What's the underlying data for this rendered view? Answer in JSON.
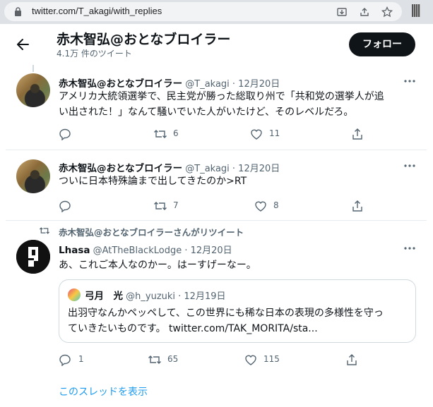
{
  "browser": {
    "url": "twitter.com/T_akagi/with_replies",
    "icons": [
      "lock-icon",
      "install-icon",
      "share-icon",
      "star-icon",
      "extension-icon"
    ]
  },
  "header": {
    "name": "赤木智弘@おとなブロイラー",
    "tweet_count": "4.1万 件のツイート",
    "follow_label": "フォロー"
  },
  "tweets": [
    {
      "name": "赤木智弘@おとなブロイラー",
      "handle_date": "@T_akagi · 12月20日",
      "text_line1": "アメリカ大統領選挙で、民主党が勝った総取り州で「共和党の選挙人が追",
      "text_line2": "い出された！」なんて騒いでいた人がいたけど、そのレベルだろ。",
      "reply_count": "",
      "retweet_count": "6",
      "like_count": "11"
    },
    {
      "name": "赤木智弘@おとなブロイラー",
      "handle_date": "@T_akagi · 12月20日",
      "text_line1": "ついに日本特殊論まで出してきたのか>RT",
      "reply_count": "",
      "retweet_count": "7",
      "like_count": "8"
    },
    {
      "retweeted_by": "赤木智弘@おとなブロイラーさんがリツイート",
      "name": "Lhasa",
      "handle_date": "@AtTheBlackLodge · 12月20日",
      "text_line1": "あ、これご本人なのかー。はーすげーなー。",
      "reply_count": "1",
      "retweet_count": "65",
      "like_count": "115",
      "quote": {
        "name": "弓月　光",
        "handle_date": "@h_yuzuki · 12月19日",
        "text_line1": "出羽守なんかペッペして、この世界にも稀な日本の表現の多様性を守っ",
        "text_line2": "ていきたいものです。 twitter.com/TAK_MORITA/sta..."
      },
      "show_thread": "このスレッドを表示"
    }
  ],
  "colors": {
    "accent": "#1d9bf0",
    "secondary_text": "#536471",
    "follow_bg": "#0f1419"
  }
}
